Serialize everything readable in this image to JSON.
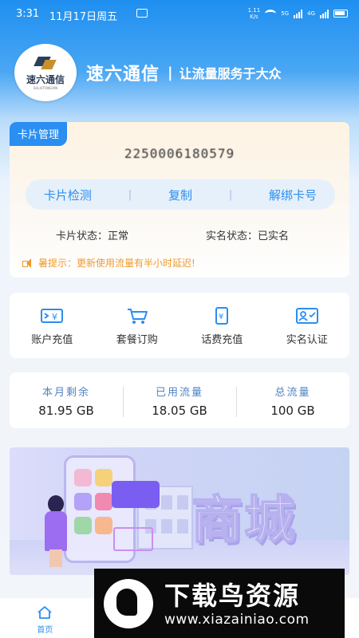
{
  "status_bar": {
    "time": "3:31",
    "date": "11月17日周五",
    "net_speed": "1.11\nK/s",
    "sim1": "5G",
    "sim2": "4G"
  },
  "header": {
    "logo_text": "速六通信",
    "logo_sub": "SULIUTONGXIN",
    "brand_name": "速六通信",
    "separator": "|",
    "slogan": "让流量服务于大众"
  },
  "card": {
    "tab_label": "卡片管理",
    "number": "2250006180579",
    "actions": [
      {
        "label": "卡片检测"
      },
      {
        "label": "复制"
      },
      {
        "label": "解绑卡号"
      }
    ],
    "action_separator": "|",
    "status_left": "卡片状态：正常",
    "status_right": "实名状态：已实名",
    "tip": "暑提示：更新使用流量有半小时延迟!"
  },
  "services": [
    {
      "label": "账户充值",
      "icon": "wallet-yen-icon"
    },
    {
      "label": "套餐订购",
      "icon": "cart-icon"
    },
    {
      "label": "话费充值",
      "icon": "phone-yen-icon"
    },
    {
      "label": "实名认证",
      "icon": "id-card-icon"
    }
  ],
  "usage": [
    {
      "label": "本月剩余",
      "value": "81.95 GB"
    },
    {
      "label": "已用流量",
      "value": "18.05 GB"
    },
    {
      "label": "总流量",
      "value": "100 GB"
    }
  ],
  "banner": {
    "title": "商城"
  },
  "bottom_nav": [
    {
      "label": "首页",
      "active": true
    },
    {
      "label": "",
      "active": false
    },
    {
      "label": "",
      "active": false
    },
    {
      "label": "",
      "active": false
    }
  ],
  "watermark": {
    "title": "下载鸟资源",
    "url": "www.xiazainiao.com"
  },
  "colors": {
    "primary": "#2a8ef2",
    "tip": "#ee9a2e",
    "usage_label": "#4f84c4"
  }
}
